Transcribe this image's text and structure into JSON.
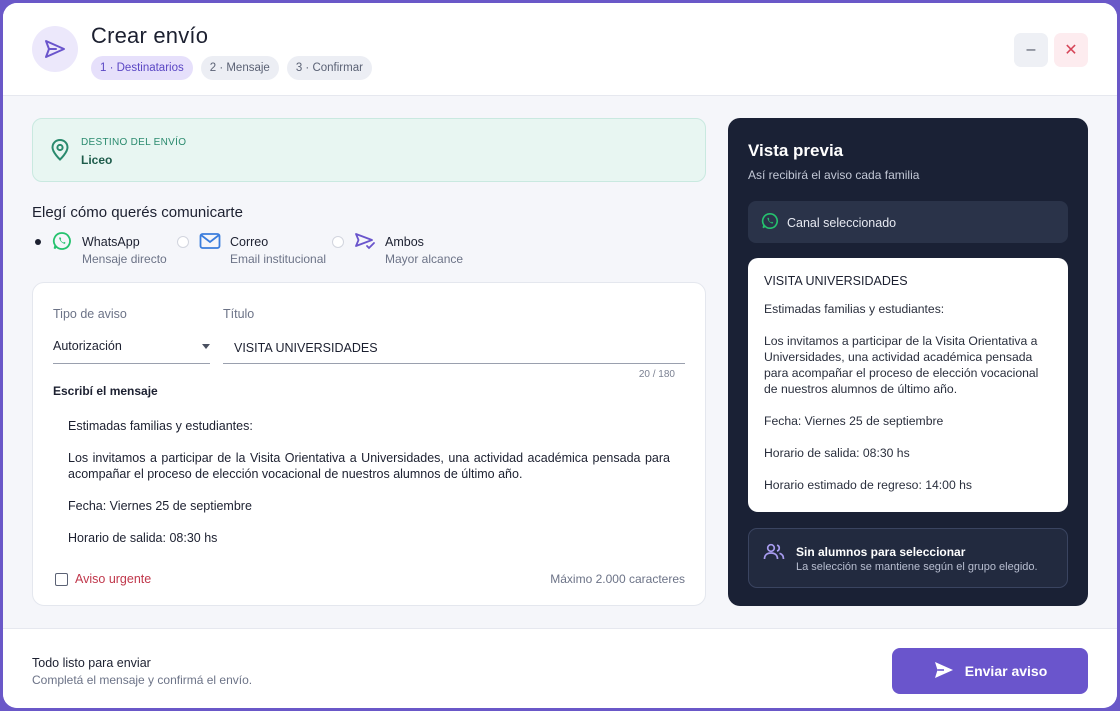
{
  "header": {
    "title": "Crear envío",
    "steps": [
      "1 · Destinatarios",
      "2 · Mensaje",
      "3 · Confirmar"
    ],
    "active_step": 0
  },
  "destination": {
    "label": "DESTINO DEL ENVÍO",
    "value": "Liceo"
  },
  "channel_section": {
    "title": "Elegí cómo querés comunicarte",
    "options": [
      {
        "name": "WhatsApp",
        "desc": "Mensaje directo",
        "selected": true,
        "icon": "whatsapp-icon"
      },
      {
        "name": "Correo",
        "desc": "Email institucional",
        "selected": false,
        "icon": "mail-icon"
      },
      {
        "name": "Ambos",
        "desc": "Mayor alcance",
        "selected": false,
        "icon": "send-check-icon"
      }
    ]
  },
  "form": {
    "type_label": "Tipo de aviso",
    "type_value": "Autorización",
    "title_label": "Título",
    "title_value": "VISITA UNIVERSIDADES",
    "counter": "20 / 180",
    "message_label": "Escribí el mensaje",
    "message_paragraphs": [
      "Estimadas familias y estudiantes:",
      "Los invitamos a participar de la Visita Orientativa a Universidades, una actividad académica pensada para acompañar el proceso de elección vocacional de nuestros alumnos de último año.",
      "Fecha: Viernes 25 de septiembre",
      "Horario de salida: 08:30 hs"
    ],
    "urgent_label": "Aviso urgente",
    "max_chars": "Máximo 2.000 caracteres"
  },
  "preview": {
    "title": "Vista previa",
    "subtitle": "Así recibirá el aviso cada familia",
    "channel_label": "Canal seleccionado",
    "message_title": "VISITA UNIVERSIDADES",
    "message_paragraphs": [
      "Estimadas familias y estudiantes:",
      "Los invitamos a participar de la Visita Orientativa a Universidades, una actividad académica pensada para acompañar el proceso de elección vocacional de nuestros alumnos de último año.",
      "Fecha: Viernes 25 de septiembre",
      "Horario de salida: 08:30 hs",
      "Horario estimado de regreso: 14:00 hs"
    ],
    "empty_title": "Sin alumnos para seleccionar",
    "empty_sub": "La selección se mantiene según el grupo elegido."
  },
  "footer": {
    "title": "Todo listo para enviar",
    "subtitle": "Completá el mensaje y confirmá el envío.",
    "send_label": "Enviar aviso"
  },
  "colors": {
    "accent": "#6a55cc",
    "whatsapp": "#25c26e",
    "mail": "#3b7ddd",
    "preview_bg": "#1a2135",
    "urgent": "#c0374b"
  }
}
